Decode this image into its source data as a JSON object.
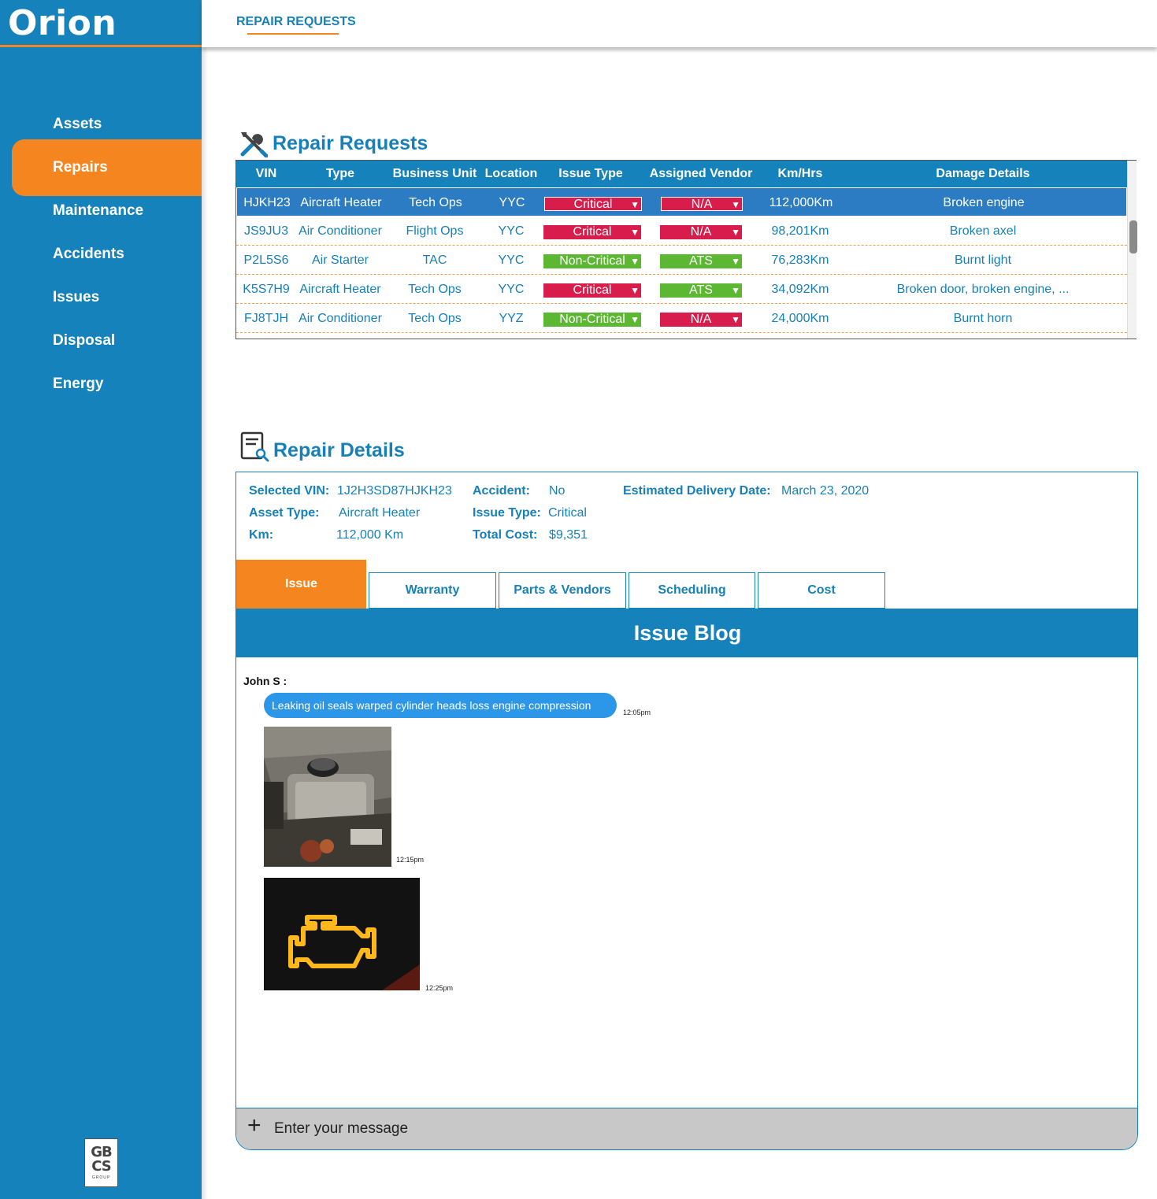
{
  "app": {
    "title": "Orion"
  },
  "sidebar": {
    "items": [
      {
        "label": "Assets"
      },
      {
        "label": "Repairs"
      },
      {
        "label": "Maintenance"
      },
      {
        "label": "Accidents"
      },
      {
        "label": "Issues"
      },
      {
        "label": "Disposal"
      },
      {
        "label": "Energy"
      }
    ],
    "active": "Repairs",
    "logo": {
      "line1": "GB",
      "line2": "CS",
      "line3": "GROUP"
    }
  },
  "topbar": {
    "tab": "REPAIR REQUESTS"
  },
  "requests": {
    "title": "Repair Requests",
    "icon": "tools-icon",
    "columns": [
      "VIN",
      "Type",
      "Business Unit",
      "Location",
      "Issue Type",
      "Assigned Vendor",
      "Km/Hrs",
      "Damage Details"
    ],
    "rows": [
      {
        "vin": "HJKH23",
        "type": "Aircraft Heater",
        "unit": "Tech Ops",
        "location": "YYC",
        "issue": "Critical",
        "vendor": "N/A",
        "km": "112,000Km",
        "damage": "Broken engine"
      },
      {
        "vin": "JS9JU3",
        "type": "Air Conditioner",
        "unit": "Flight Ops",
        "location": "YYC",
        "issue": "Critical",
        "vendor": "N/A",
        "km": "98,201Km",
        "damage": "Broken axel"
      },
      {
        "vin": "P2L5S6",
        "type": "Air Starter",
        "unit": "TAC",
        "location": "YYC",
        "issue": "Non-Critical",
        "vendor": "ATS",
        "km": "76,283Km",
        "damage": "Burnt light"
      },
      {
        "vin": "K5S7H9",
        "type": "Aircraft Heater",
        "unit": "Tech Ops",
        "location": "YYC",
        "issue": "Critical",
        "vendor": "ATS",
        "km": "34,092Km",
        "damage": "Broken door, broken engine, ..."
      },
      {
        "vin": "FJ8TJH",
        "type": "Air Conditioner",
        "unit": "Tech Ops",
        "location": "YYZ",
        "issue": "Non-Critical",
        "vendor": "N/A",
        "km": "24,000Km",
        "damage": "Burnt horn"
      }
    ],
    "selected_row": 0
  },
  "details": {
    "title": "Repair Details",
    "icon": "document-search-icon",
    "selected_vin_label": "Selected VIN:",
    "selected_vin": "1J2H3SD87HJKH23",
    "asset_type_label": "Asset Type:",
    "asset_type": "Aircraft Heater",
    "km_label": "Km:",
    "km": "112,000 Km",
    "accident_label": "Accident:",
    "accident": "No",
    "issue_type_label": "Issue Type:",
    "issue_type": "Critical",
    "total_cost_label": "Total Cost:",
    "total_cost": "$9,351",
    "delivery_label": "Estimated Delivery Date:",
    "delivery": "March 23, 2020",
    "tabs": [
      "Issue",
      "Warranty",
      "Parts & Vendors",
      "Scheduling",
      "Cost"
    ],
    "active_tab": "Issue"
  },
  "blog": {
    "title": "Issue Blog",
    "author": "John S :",
    "messages": [
      {
        "kind": "text",
        "text": "Leaking oil seals warped cylinder heads loss engine compression",
        "time": "12:05pm"
      },
      {
        "kind": "image",
        "subject": "engine-photo",
        "time": "12:15pm"
      },
      {
        "kind": "image",
        "subject": "check-engine-light-photo",
        "time": "12:25pm"
      }
    ],
    "compose_placeholder": "Enter your message",
    "compose_icon": "plus-icon"
  },
  "colors": {
    "primary": "#1582bb",
    "accent": "#f5861f",
    "critical": "#d81c4b",
    "non_critical": "#5cb833",
    "bubble": "#2c96e8"
  }
}
